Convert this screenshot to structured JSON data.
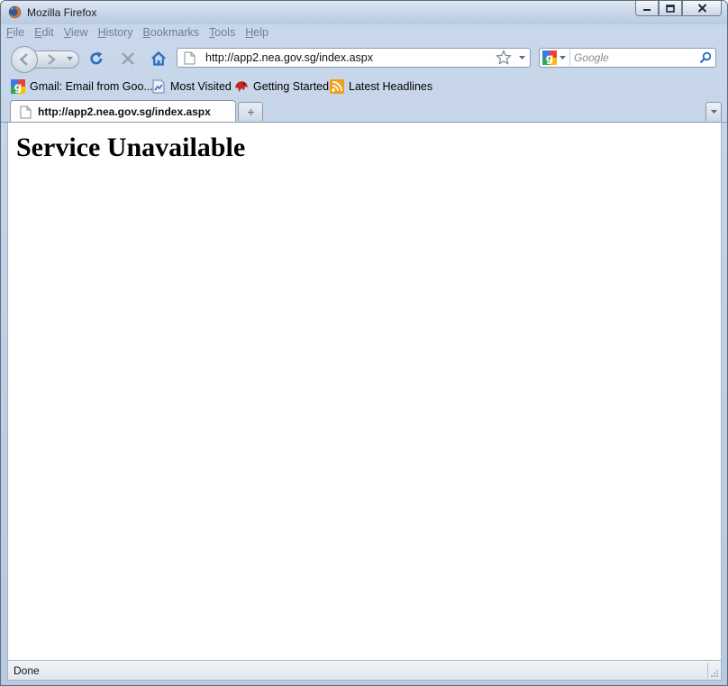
{
  "window": {
    "title": "Mozilla Firefox"
  },
  "menu": [
    "File",
    "Edit",
    "View",
    "History",
    "Bookmarks",
    "Tools",
    "Help"
  ],
  "navbar": {
    "url": "http://app2.nea.gov.sg/index.aspx",
    "search_placeholder": "Google"
  },
  "bookmarks": [
    {
      "label": "Gmail: Email from Goo...",
      "icon": "google-icon"
    },
    {
      "label": "Most Visited",
      "icon": "most-visited-icon"
    },
    {
      "label": "Getting Started",
      "icon": "firefox-icon"
    },
    {
      "label": "Latest Headlines",
      "icon": "rss-icon"
    }
  ],
  "tab": {
    "label": "http://app2.nea.gov.sg/index.aspx"
  },
  "page": {
    "heading": "Service Unavailable"
  },
  "status": {
    "text": "Done"
  },
  "colors": {
    "chrome": "#c9d8ea",
    "content": "#ffffff",
    "reload_blue": "#2f6cc4"
  }
}
